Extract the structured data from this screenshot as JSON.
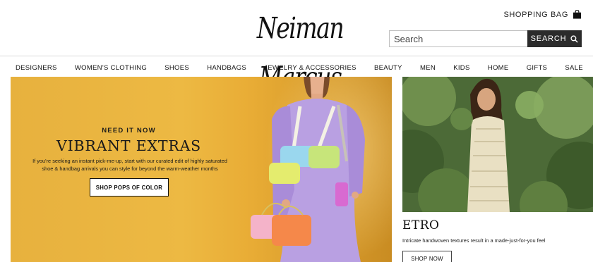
{
  "header": {
    "logo_text": "Neiman Marcus",
    "shopping_bag_label": "SHOPPING BAG",
    "search": {
      "placeholder": "Search",
      "button_label": "SEARCH"
    }
  },
  "nav": {
    "items": [
      "DESIGNERS",
      "WOMEN'S CLOTHING",
      "SHOES",
      "HANDBAGS",
      "JEWELRY & ACCESSORIES",
      "BEAUTY",
      "MEN",
      "KIDS",
      "HOME",
      "GIFTS",
      "SALE"
    ]
  },
  "hero": {
    "eyebrow": "NEED IT NOW",
    "title": "VIBRANT EXTRAS",
    "copy": "If you're seeking an instant pick-me-up, start with our curated edit of highly saturated shoe & handbag arrivals you can style for beyond the warm-weather months",
    "cta_label": "SHOP POPS OF COLOR",
    "background_color": "#ecb540"
  },
  "promo": {
    "title": "ETRO",
    "copy": "Intricate handwoven textures result in a made-just-for-you feel",
    "cta_label": "SHOP NOW"
  },
  "colors": {
    "search_button": "#2b2b2b",
    "text": "#111111",
    "divider": "#d9d9d9"
  },
  "icons": [
    "shopping-bag-icon",
    "search-icon"
  ]
}
